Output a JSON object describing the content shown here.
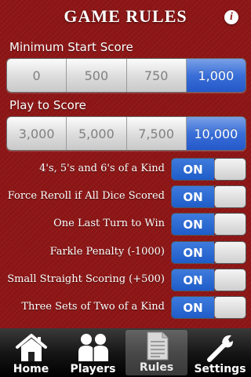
{
  "header": {
    "title": "GAME RULES",
    "info_icon_glyph": "i"
  },
  "min_start": {
    "label": "Minimum  Start Score",
    "options": [
      "0",
      "500",
      "750",
      "1,000"
    ],
    "selected": "1,000"
  },
  "play_to": {
    "label": "Play to Score",
    "options": [
      "3,000",
      "5,000",
      "7,500",
      "10,000"
    ],
    "selected": "10,000"
  },
  "rules": [
    {
      "label": "4's, 5's and 6's of a Kind",
      "state": "ON"
    },
    {
      "label": "Force Reroll if All Dice Scored",
      "state": "ON"
    },
    {
      "label": "One Last Turn to Win",
      "state": "ON"
    },
    {
      "label": "Farkle Penalty (-1000)",
      "state": "ON"
    },
    {
      "label": "Small Straight Scoring (+500)",
      "state": "ON"
    },
    {
      "label": "Three Sets of Two of a Kind",
      "state": "ON"
    }
  ],
  "tabbar": {
    "tabs": [
      {
        "label": "Home",
        "icon": "home-icon"
      },
      {
        "label": "Players",
        "icon": "players-icon"
      },
      {
        "label": "Rules",
        "icon": "rules-icon"
      },
      {
        "label": "Settings",
        "icon": "settings-icon"
      }
    ],
    "selected": "Rules"
  },
  "colors": {
    "background": "#8e1616",
    "accent_blue": "#2558c9"
  }
}
